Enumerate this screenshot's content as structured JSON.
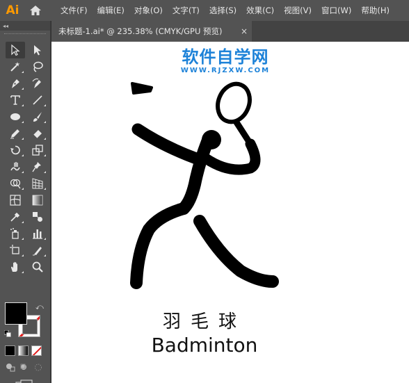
{
  "app": {
    "logo": "Ai"
  },
  "menu": [
    "文件(F)",
    "编辑(E)",
    "对象(O)",
    "文字(T)",
    "选择(S)",
    "效果(C)",
    "视图(V)",
    "窗口(W)",
    "帮助(H)"
  ],
  "tools_header": "◂◂",
  "tools": [
    "selection-tool",
    "direct-selection-tool",
    "magic-wand-tool",
    "lasso-tool",
    "pen-tool",
    "curvature-tool",
    "type-tool",
    "line-segment-tool",
    "ellipse-tool",
    "paintbrush-tool",
    "shaper-tool",
    "eraser-tool",
    "rotate-tool",
    "scale-tool",
    "warp-tool",
    "puppet-warp-tool",
    "shape-builder-tool",
    "perspective-grid-tool",
    "mesh-tool",
    "gradient-tool",
    "eyedropper-tool",
    "blend-tool",
    "symbol-sprayer-tool",
    "column-graph-tool",
    "artboard-tool",
    "slice-tool",
    "hand-tool",
    "zoom-tool"
  ],
  "document_tab": {
    "title": "未标题-1.ai* @ 235.38% (CMYK/GPU 预览)",
    "close": "×"
  },
  "artwork": {
    "watermark_main": "软件自学网",
    "watermark_sub": "WWW.RJZXW.COM",
    "title_cn": "羽毛球",
    "title_en": "Badminton"
  },
  "colors": {
    "accent_orange": "#ff9a00",
    "watermark_blue": "#1d82d8",
    "fill": "#000000",
    "stroke_none_red": "#e21b1b"
  }
}
